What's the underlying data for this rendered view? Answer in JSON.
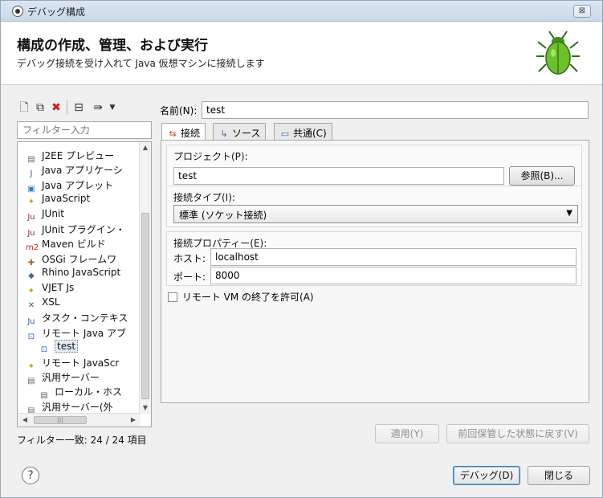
{
  "window": {
    "title": "デバッグ構成",
    "close_symbol": "⊠"
  },
  "header": {
    "title": "構成の作成、管理、および実行",
    "subtitle": "デバッグ接続を受け入れて Java 仮想マシンに接続します"
  },
  "left": {
    "filter_placeholder": "フィルター入力",
    "tree": [
      {
        "label": "J2EE プレビュー",
        "icon": "server-icon",
        "glyph": "▤",
        "color": "#6a6a6a",
        "indent": 0
      },
      {
        "label": "Java アプリケーシ",
        "icon": "java-app-icon",
        "glyph": "J",
        "color": "#2a5db0",
        "indent": 0
      },
      {
        "label": "Java アプレット",
        "icon": "applet-icon",
        "glyph": "▣",
        "color": "#3a7ac0",
        "indent": 0
      },
      {
        "label": "JavaScript",
        "icon": "javascript-icon",
        "glyph": "✦",
        "color": "#c8a000",
        "indent": 0
      },
      {
        "label": "JUnit",
        "icon": "junit-icon",
        "glyph": "Ju",
        "color": "#8a2c2c",
        "indent": 0
      },
      {
        "label": "JUnit プラグイン・",
        "icon": "junit-plugin-icon",
        "glyph": "Ju",
        "color": "#8a2c2c",
        "indent": 0
      },
      {
        "label": "Maven ビルド",
        "icon": "maven-icon",
        "glyph": "m2",
        "color": "#c0282d",
        "indent": 0
      },
      {
        "label": "OSGi フレームワ",
        "icon": "osgi-icon",
        "glyph": "✚",
        "color": "#b5651d",
        "indent": 0
      },
      {
        "label": "Rhino JavaScript",
        "icon": "rhino-icon",
        "glyph": "◆",
        "color": "#4a6a9a",
        "indent": 0
      },
      {
        "label": "VJET Js",
        "icon": "vjet-icon",
        "glyph": "✦",
        "color": "#c8a000",
        "indent": 0
      },
      {
        "label": "XSL",
        "icon": "xsl-icon",
        "glyph": "✕",
        "color": "#555555",
        "indent": 0
      },
      {
        "label": "タスク・コンテキス",
        "icon": "task-context-icon",
        "glyph": "Ju",
        "color": "#2a5db0",
        "indent": 0
      },
      {
        "label": "リモート Java アブ",
        "icon": "remote-java-icon",
        "glyph": "⊡",
        "color": "#2a5db0",
        "indent": 0
      },
      {
        "label": "test",
        "icon": "launch-config-icon",
        "glyph": "⊡",
        "color": "#2a5db0",
        "indent": 1,
        "selected": true
      },
      {
        "label": "リモート JavaScr",
        "icon": "remote-javascript-icon",
        "glyph": "✦",
        "color": "#c8a000",
        "indent": 0
      },
      {
        "label": "汎用サーバー",
        "icon": "generic-server-icon",
        "glyph": "▤",
        "color": "#6a6a6a",
        "indent": 0
      },
      {
        "label": "ローカル・ホス",
        "icon": "local-host-icon",
        "glyph": "▤",
        "color": "#6a6a6a",
        "indent": 1
      },
      {
        "label": "汎用サーバー(外",
        "icon": "external-server-icon",
        "glyph": "▤",
        "color": "#6a6a6a",
        "indent": 0
      }
    ],
    "filter_status": "フィルター一致: 24 / 24 項目"
  },
  "right": {
    "name_label": "名前(N):",
    "name_value": "test",
    "tabs": [
      {
        "label": "接続",
        "icon": "connect-icon",
        "glyph": "⇆",
        "color": "#b05a1a",
        "active": true
      },
      {
        "label": "ソース",
        "icon": "source-icon",
        "glyph": "↳",
        "color": "#3a6ab0",
        "active": false
      },
      {
        "label": "共通(C)",
        "icon": "common-icon",
        "glyph": "▭",
        "color": "#3a6ab0",
        "active": false
      }
    ],
    "project_group": {
      "title": "プロジェクト(P):",
      "value": "test",
      "browse_label": "参照(B)..."
    },
    "connection_type_group": {
      "title": "接続タイプ(I):",
      "selected": "標準 (ソケット接続)"
    },
    "properties_group": {
      "title": "接続プロパティー(E):",
      "host_label": "ホスト:",
      "host_value": "localhost",
      "port_label": "ポート:",
      "port_value": "8000"
    },
    "allow_termination_label": "リモート VM の終了を許可(A)",
    "allow_termination_checked": false,
    "apply_label": "適用(Y)",
    "revert_label": "前回保管した状態に戻す(V)"
  },
  "footer": {
    "help_symbol": "?",
    "debug_label": "デバッグ(D)",
    "close_label": "閉じる"
  }
}
